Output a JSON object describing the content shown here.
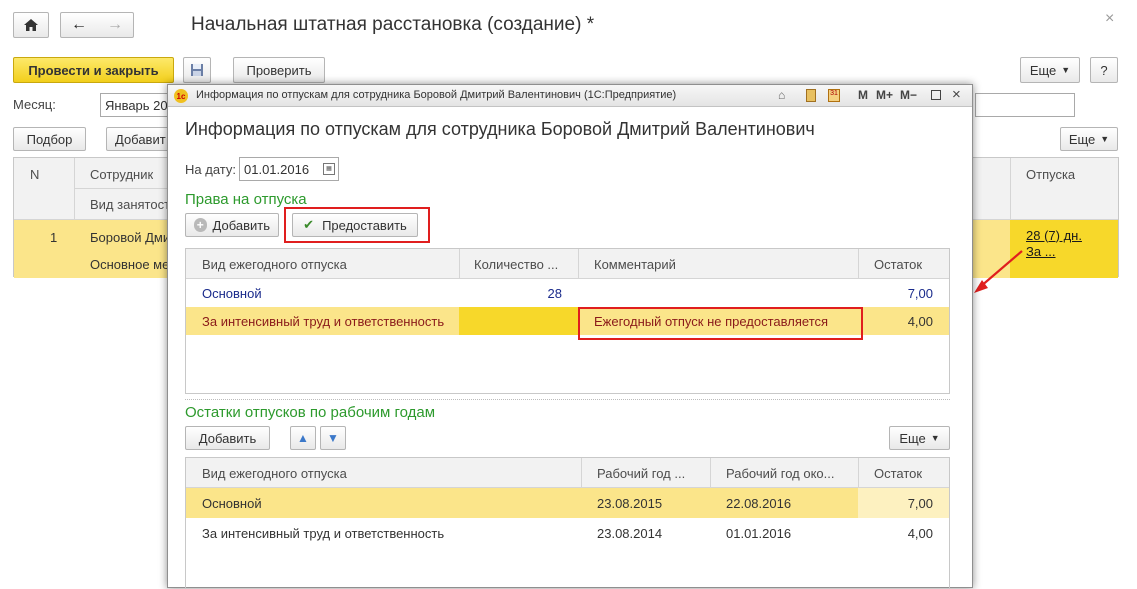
{
  "main": {
    "title": "Начальная штатная расстановка (создание) *",
    "post_close_label": "Провести и закрыть",
    "check_label": "Проверить",
    "more_label": "Еще",
    "help_label": "?",
    "month_label": "Месяц:",
    "month_value": "Январь 20",
    "select_label": "Подбор",
    "add_label": "Добавит",
    "more2_label": "Еще",
    "table": {
      "col_n": "N",
      "col_employee": "Сотрудник",
      "col_employment": "Вид занятост",
      "col_vacations": "Отпуска",
      "row": {
        "n": "1",
        "employee": "Боровой Дми",
        "employment": "Основное ме",
        "vacations_line1": "28 (7) дн.",
        "vacations_line2": "За ..."
      }
    }
  },
  "dialog": {
    "window_title": "Информация по отпускам для сотрудника Боровой Дмитрий Валентинович  (1С:Предприятие)",
    "heading": "Информация по отпускам для сотрудника Боровой Дмитрий Валентинович",
    "date_label": "На дату:",
    "date_value": "01.01.2016",
    "rights_section": "Права на отпуска",
    "add_label": "Добавить",
    "grant_label": "Предоставить",
    "rights_table": {
      "headers": [
        "Вид ежегодного отпуска",
        "Количество ...",
        "Комментарий",
        "Остаток"
      ],
      "rows": [
        {
          "type": "Основной",
          "count": "28",
          "comment": "",
          "rest": "7,00"
        },
        {
          "type": "За интенсивный труд и ответственность",
          "count": "",
          "comment": "Ежегодный отпуск не предоставляется",
          "rest": "4,00"
        }
      ]
    },
    "balances_section": "Остатки отпусков по рабочим годам",
    "add2_label": "Добавить",
    "more_label": "Еще",
    "balances_table": {
      "headers": [
        "Вид ежегодного отпуска",
        "Рабочий год ...",
        "Рабочий год око...",
        "Остаток"
      ],
      "rows": [
        {
          "type": "Основной",
          "start": "23.08.2015",
          "end": "22.08.2016",
          "rest": "7,00"
        },
        {
          "type": "За интенсивный труд и ответственность",
          "start": "23.08.2014",
          "end": "01.01.2016",
          "rest": "4,00"
        }
      ]
    }
  },
  "colors": {
    "accent_yellow": "#f2cf1c",
    "selected_row": "#fbe58a",
    "section_green": "#2d9a2d",
    "highlight_red": "#e01e1e"
  }
}
